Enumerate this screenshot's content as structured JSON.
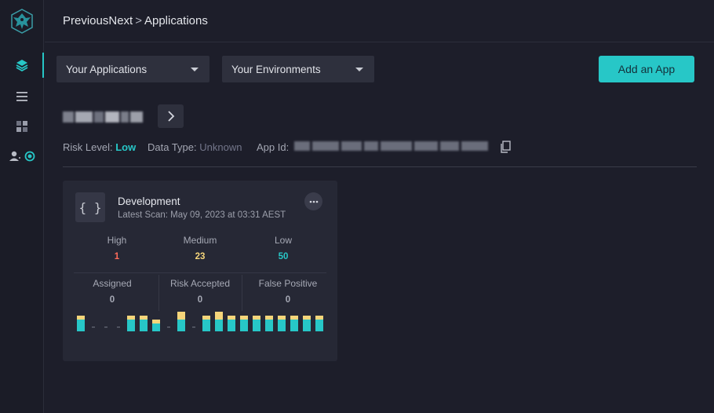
{
  "breadcrumb": {
    "org": "PreviousNext",
    "separator": ">",
    "page": "Applications"
  },
  "sidebar": {
    "logo": "phoenix-logo",
    "items": [
      {
        "icon": "layers-icon"
      },
      {
        "icon": "list-icon"
      },
      {
        "icon": "grid-icon"
      },
      {
        "icon": "user-settings-icon"
      }
    ]
  },
  "filters": {
    "applications": "Your Applications",
    "environments": "Your Environments"
  },
  "add_app_label": "Add an App",
  "app": {
    "risk_level_label": "Risk Level:",
    "risk_level_value": "Low",
    "data_type_label": "Data Type:",
    "data_type_value": "Unknown",
    "app_id_label": "App Id:"
  },
  "colors": {
    "accent": "#27c7c7",
    "high": "#ff6b5a",
    "medium": "#f5d57a",
    "low": "#27c7c7"
  },
  "environment_card": {
    "icon_glyph": "{ }",
    "title": "Development",
    "latest_scan": "Latest Scan: May 09, 2023 at 03:31 AEST",
    "severity": [
      {
        "label": "High",
        "value": "1"
      },
      {
        "label": "Medium",
        "value": "23"
      },
      {
        "label": "Low",
        "value": "50"
      }
    ],
    "triage": [
      {
        "label": "Assigned",
        "value": "0"
      },
      {
        "label": "Risk Accepted",
        "value": "0"
      },
      {
        "label": "False Positive",
        "value": "0"
      }
    ],
    "history": [
      {
        "medium": 1,
        "low": 3
      },
      {
        "medium": 0,
        "low": 0
      },
      {
        "medium": 0,
        "low": 0
      },
      {
        "medium": 0,
        "low": 0
      },
      {
        "medium": 1,
        "low": 3
      },
      {
        "medium": 1,
        "low": 3
      },
      {
        "medium": 1,
        "low": 2
      },
      {
        "medium": 0,
        "low": 0
      },
      {
        "medium": 2,
        "low": 3
      },
      {
        "medium": 0,
        "low": 0
      },
      {
        "medium": 1,
        "low": 3
      },
      {
        "medium": 2,
        "low": 3
      },
      {
        "medium": 1,
        "low": 3
      },
      {
        "medium": 1,
        "low": 3
      },
      {
        "medium": 1,
        "low": 3
      },
      {
        "medium": 1,
        "low": 3
      },
      {
        "medium": 1,
        "low": 3
      },
      {
        "medium": 1,
        "low": 3
      },
      {
        "medium": 1,
        "low": 3
      },
      {
        "medium": 1,
        "low": 3
      }
    ]
  }
}
